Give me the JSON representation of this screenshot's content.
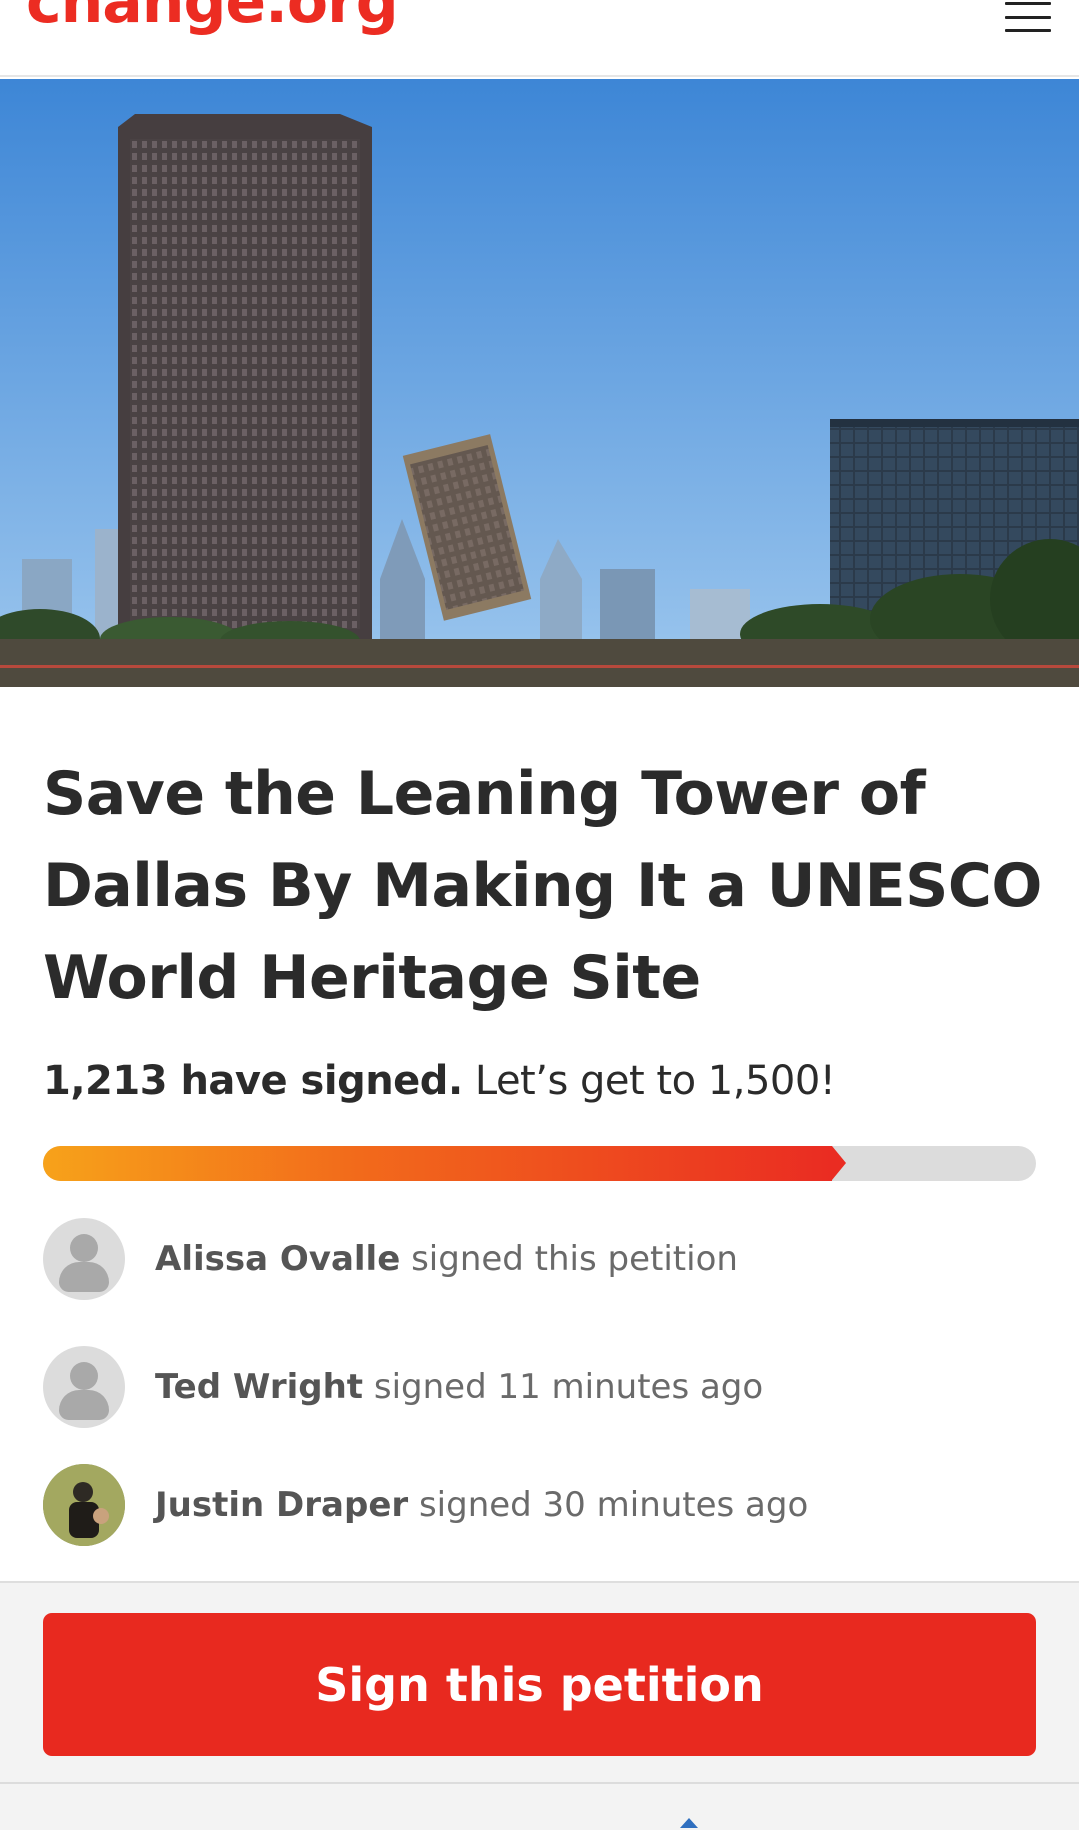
{
  "header": {
    "logo_text": "change.org",
    "menu_icon": "hamburger-menu-icon"
  },
  "petition": {
    "title": "Save the Leaning Tower of Dallas By Making It a UNESCO World Heritage Site",
    "signed_count": "1,213 have signed.",
    "goal_text": "Let’s get to 1,500!",
    "progress": 0.8087
  },
  "signers": [
    {
      "name": "Alissa Ovalle",
      "action": "signed this petition",
      "avatar": "default-avatar-icon"
    },
    {
      "name": "Ted Wright",
      "action": "signed 11 minutes ago",
      "avatar": "default-avatar-icon"
    },
    {
      "name": "Justin Draper",
      "action": "signed 30 minutes ago",
      "avatar": "user-photo"
    }
  ],
  "cta": {
    "sign_label": "Sign this petition"
  },
  "colors": {
    "brand_red": "#ec2c22",
    "progress_start": "#f7a21a",
    "progress_end": "#ea2c22",
    "track": "#dcdcdc"
  }
}
